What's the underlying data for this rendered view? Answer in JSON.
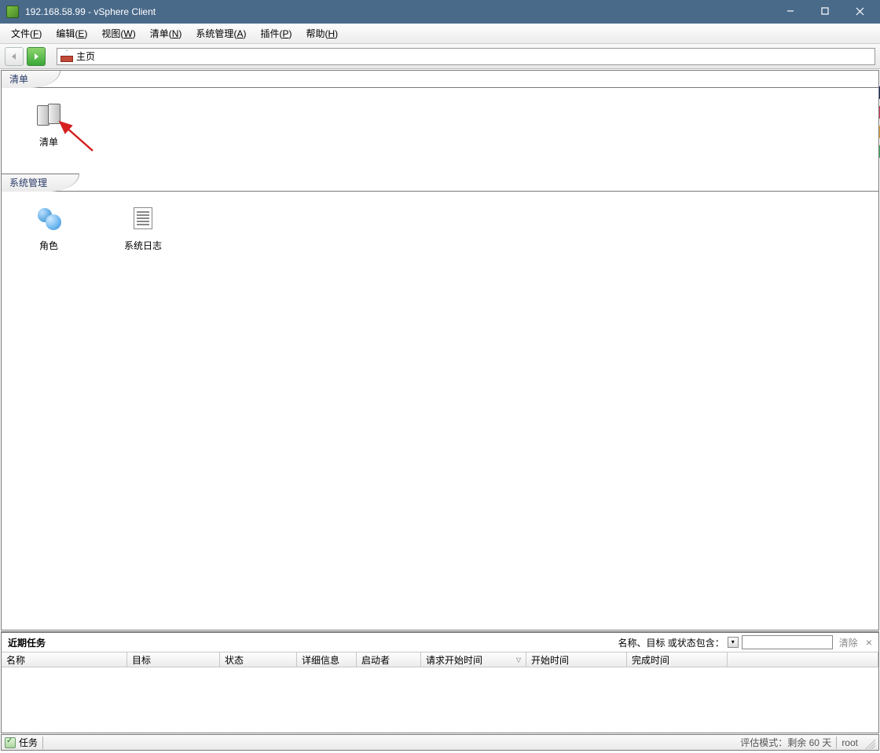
{
  "titlebar": {
    "title": "192.168.58.99 - vSphere Client"
  },
  "menubar": {
    "items": [
      {
        "label": "文件",
        "accel": "F"
      },
      {
        "label": "编辑",
        "accel": "E"
      },
      {
        "label": "视图",
        "accel": "W"
      },
      {
        "label": "清单",
        "accel": "N"
      },
      {
        "label": "系统管理",
        "accel": "A"
      },
      {
        "label": "插件",
        "accel": "P"
      },
      {
        "label": "帮助",
        "accel": "H"
      }
    ]
  },
  "toolbar": {
    "location": "主页"
  },
  "sections": {
    "inventory": {
      "header": "清单",
      "items": [
        {
          "label": "清单",
          "icon": "servers"
        }
      ]
    },
    "admin": {
      "header": "系统管理",
      "items": [
        {
          "label": "角色",
          "icon": "roles"
        },
        {
          "label": "系统日志",
          "icon": "log"
        }
      ]
    }
  },
  "tasks": {
    "panel_title": "近期任务",
    "filter_label": "名称、目标 或状态包含：",
    "filter_value": "",
    "clear_label": "清除",
    "columns": {
      "name": "名称",
      "target": "目标",
      "status": "状态",
      "detail": "详细信息",
      "starter": "启动者",
      "req_time": "请求开始时间",
      "start_time": "开始时间",
      "end_time": "完成时间"
    }
  },
  "statusbar": {
    "tasks_label": "任务",
    "eval_text": "评估模式：剩余 60 天",
    "watermark_suffix": "root"
  }
}
